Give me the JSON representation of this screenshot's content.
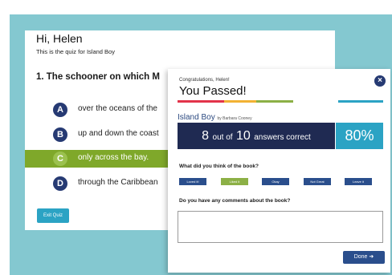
{
  "caption": "",
  "quiz": {
    "greeting": "Hi, Helen",
    "subtitle": "This is the quiz for Island Boy",
    "question": "1. The schooner on which M",
    "options": [
      {
        "letter": "A",
        "text": "over the oceans of the"
      },
      {
        "letter": "B",
        "text": "up and down the coast"
      },
      {
        "letter": "C",
        "text": "only across the bay."
      },
      {
        "letter": "D",
        "text": "through the Caribbean"
      }
    ],
    "selected_letter": "C",
    "exit_label": "Exit Quiz"
  },
  "modal": {
    "congrats": "Congratulations, Helen!",
    "headline": "You Passed!",
    "close_symbol": "×",
    "book_title": "Island Boy",
    "book_author": "by Barbara Cooney",
    "score_correct": "8",
    "score_of": "out of",
    "score_total": "10",
    "score_suffix": "answers correct",
    "percent": "80%",
    "rating_question": "What did you think of the book?",
    "rating_options": [
      "Loved it!",
      "Liked it",
      "Okay",
      "Not Great",
      "Leave it"
    ],
    "rating_selected": "Liked it",
    "comment_question": "Do you have any comments about the book?",
    "comment_value": "",
    "done_label": "Done",
    "done_arrow": "➜"
  },
  "colors": {
    "panel": "#84c8d0",
    "navy": "#1f2a52",
    "accent_blue": "#2ba3c4",
    "selected_green": "#7fa82a",
    "stripe": [
      "#e2334a",
      "#f2b233",
      "#8cb046",
      "#2ba3c4",
      "#8a5aa8"
    ]
  }
}
